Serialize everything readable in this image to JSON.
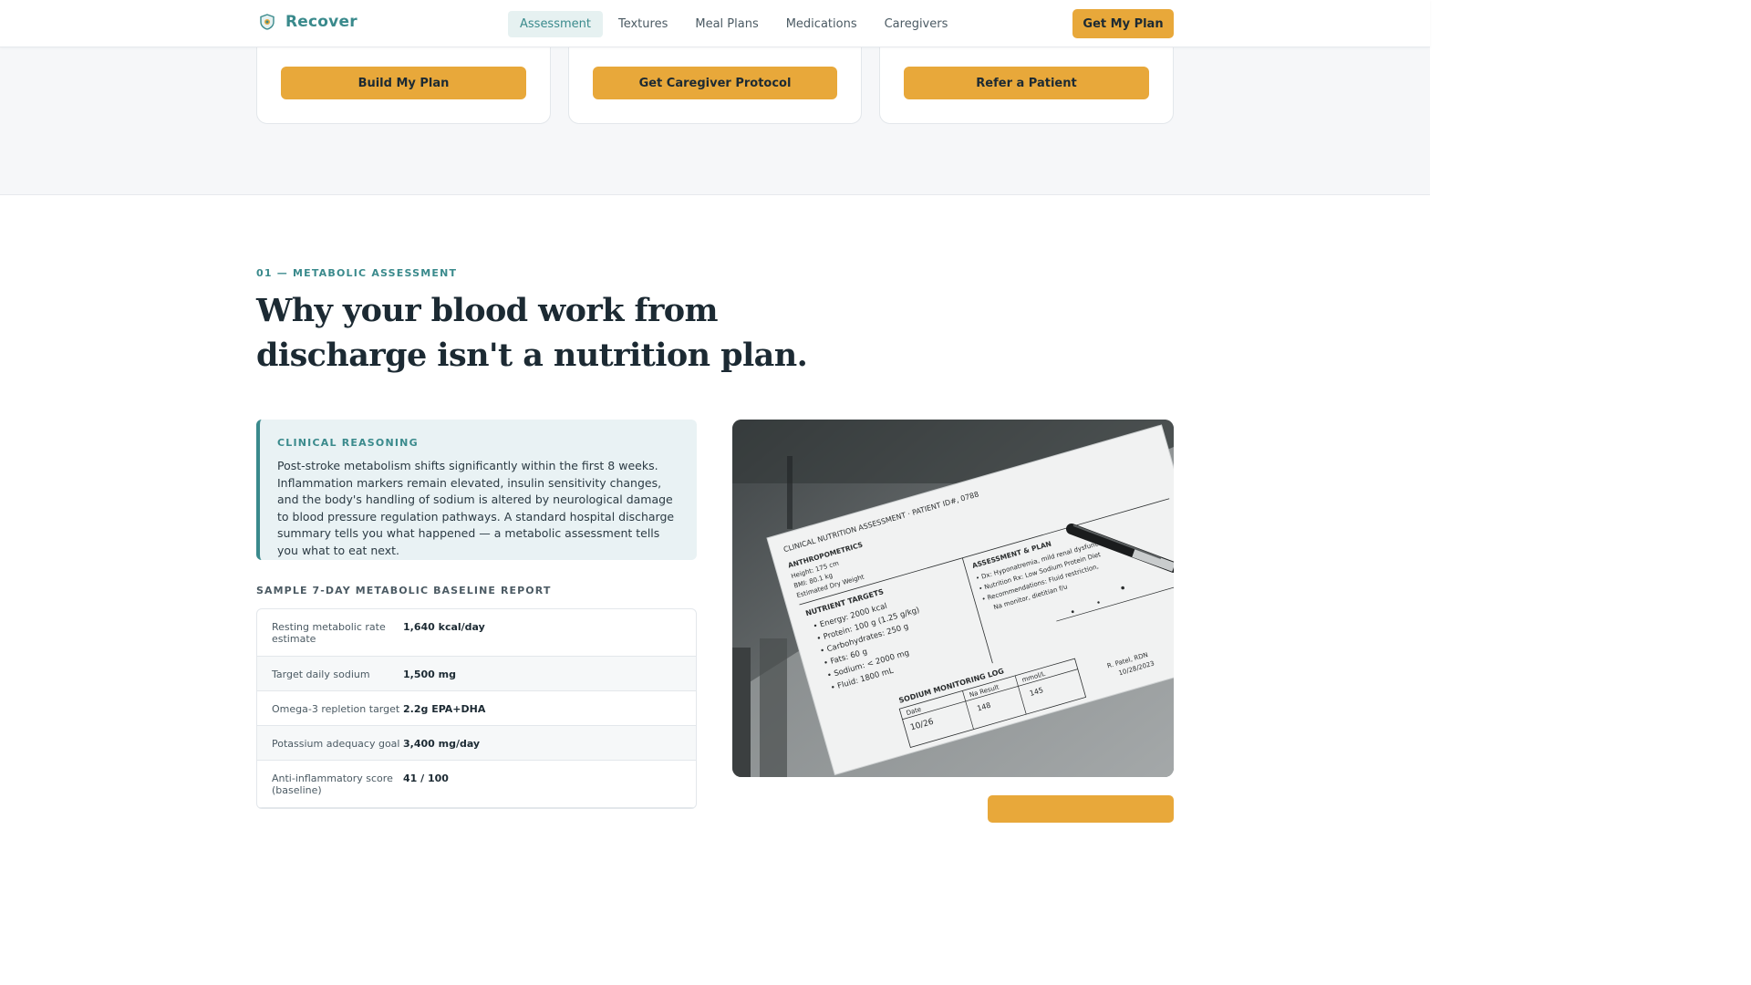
{
  "brand": {
    "name": "Recover",
    "accent": "#3a8a8c",
    "cta_color": "#e8a83a"
  },
  "nav": {
    "items": [
      {
        "label": "Assessment",
        "active": true
      },
      {
        "label": "Textures",
        "active": false
      },
      {
        "label": "Meal Plans",
        "active": false
      },
      {
        "label": "Medications",
        "active": false
      },
      {
        "label": "Caregivers",
        "active": false
      }
    ],
    "cta_label": "Get My Plan"
  },
  "cards": [
    {
      "cta_label": "Build My Plan"
    },
    {
      "cta_label": "Get Caregiver Protocol"
    },
    {
      "cta_label": "Refer a Patient"
    }
  ],
  "section": {
    "eyebrow": "01 — METABOLIC ASSESSMENT",
    "title": "Why your blood work from discharge isn't a nutrition plan.",
    "callout": {
      "label": "CLINICAL REASONING",
      "body": "Post-stroke metabolism shifts significantly within the first 8 weeks. Inflammation markers remain elevated, insulin sensitivity changes, and the body's handling of sodium is altered by neurological damage to blood pressure regulation pathways. A standard hospital discharge summary tells you what happened — a metabolic assessment tells you what to eat next."
    },
    "report": {
      "label": "SAMPLE 7-DAY METABOLIC BASELINE REPORT",
      "rows": [
        {
          "key": "Resting metabolic rate estimate",
          "value": "1,640 kcal/day"
        },
        {
          "key": "Target daily sodium",
          "value": "1,500 mg"
        },
        {
          "key": "Omega-3 repletion target",
          "value": "2.2g EPA+DHA"
        },
        {
          "key": "Potassium adequacy goal",
          "value": "3,400 mg/day"
        },
        {
          "key": "Anti-inflammatory score (baseline)",
          "value": "41 / 100"
        }
      ]
    }
  },
  "photo": {
    "icon": "clinical-form-photo",
    "form_lines": [
      "CLINICAL NUTRITION ASSESSMENT · PATIENT ID#, 0788",
      "ANTHROPOMETRICS",
      "Height:   175 cm",
      "BMI:       80.1 kg",
      "Estimated Dry Weight",
      "NUTRIENT TARGETS",
      "• Energy: 2000 kcal",
      "• Protein: 100 g (1.25 g/kg)",
      "• Carbohydrates:  250 g",
      "• Fats:        60 g",
      "• Sodium:  < 2000 mg",
      "• Fluid:  1800 mL",
      "ASSESSMENT & PLAN",
      "• Dx: Hyponatremia, mild renal dysfunction",
      "• Nutrition Rx: Low Sodium Protein Diet",
      "• Recommendations: Fluid restriction,",
      "Na monitor, dietitian f/u",
      "SODIUM MONITORING LOG",
      "Date",
      "Na Result",
      "mmol/L",
      "10/26",
      "148",
      "145",
      "R. Patel, RDN",
      "10/28/2023"
    ]
  }
}
